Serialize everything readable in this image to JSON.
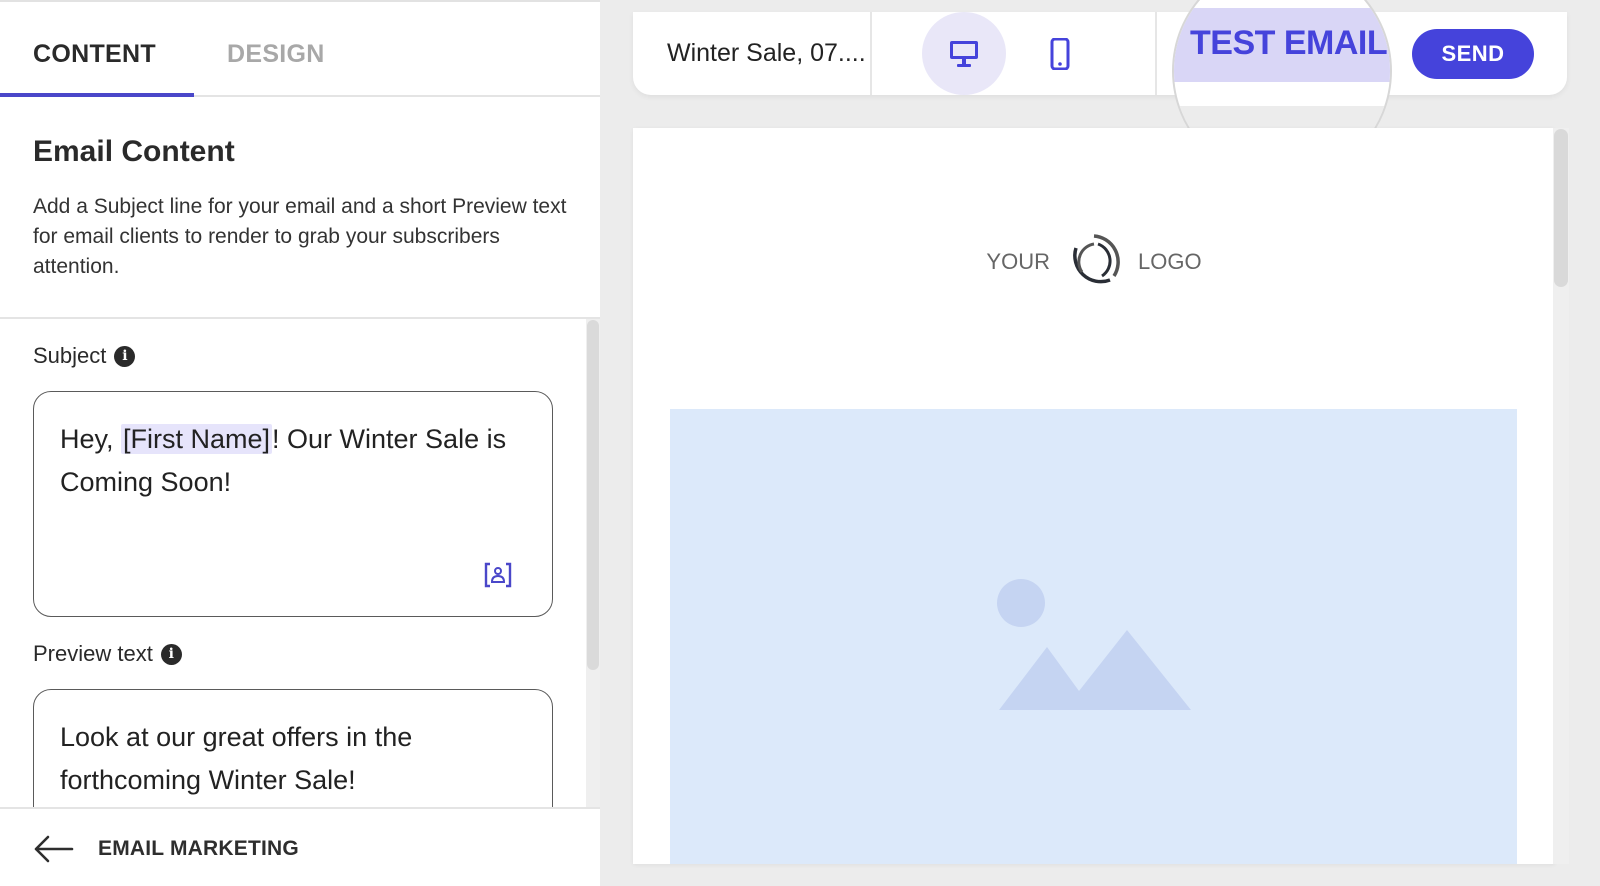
{
  "tabs": {
    "content": "CONTENT",
    "design": "DESIGN",
    "active": "CONTENT"
  },
  "intro": {
    "title": "Email Content",
    "description": "Add a Subject line for your email and a short Preview text for email clients to render to grab your subscribers attention."
  },
  "subject": {
    "label": "Subject",
    "value_prefix": "Hey, ",
    "merge_tag": "[First Name]",
    "value_suffix": "! Our Winter Sale is Coming Soon!",
    "info_icon": "info-icon",
    "personalize_icon": "personalize-icon"
  },
  "preview": {
    "label": "Preview text",
    "value": "Look at our great offers in the forthcoming Winter Sale!",
    "info_icon": "info-icon"
  },
  "footer": {
    "back_label": "EMAIL MARKETING",
    "back_icon": "arrow-left-icon"
  },
  "toolbar": {
    "title": "Winter Sale, 07....",
    "desktop_icon": "desktop-icon",
    "mobile_icon": "mobile-icon",
    "active_device": "desktop",
    "test_email_label": "TEST EMAIL",
    "send_label": "SEND"
  },
  "email_preview": {
    "logo_left": "YOUR",
    "logo_right": "LOGO",
    "image_icon": "image-placeholder-icon"
  },
  "colors": {
    "accent": "#4543db",
    "accent_light": "#e9e7f8",
    "highlight": "#d9d6f6",
    "image_placeholder_bg": "#dce9fa",
    "image_placeholder_fg": "#c5d4f2"
  }
}
